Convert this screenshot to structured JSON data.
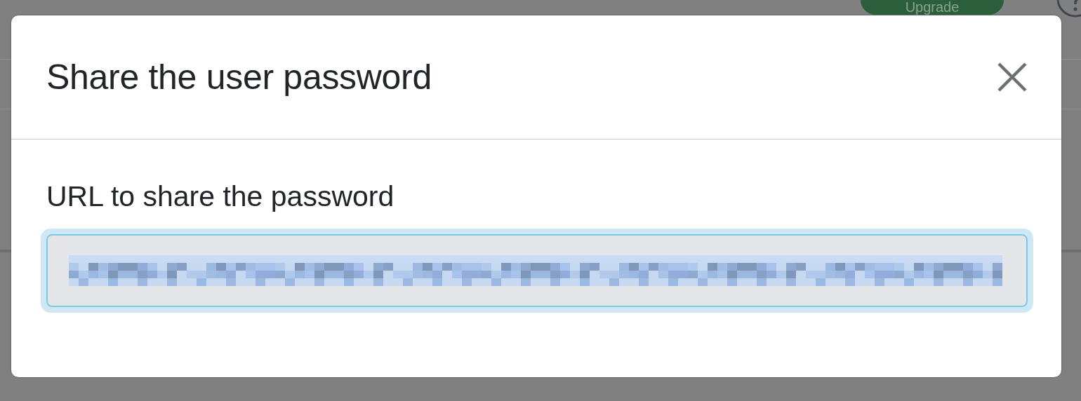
{
  "background": {
    "upgrade_button": "Upgrade"
  },
  "dialog": {
    "title": "Share the user password",
    "field": {
      "label": "URL to share the password",
      "focused": true,
      "redacted": true
    }
  }
}
